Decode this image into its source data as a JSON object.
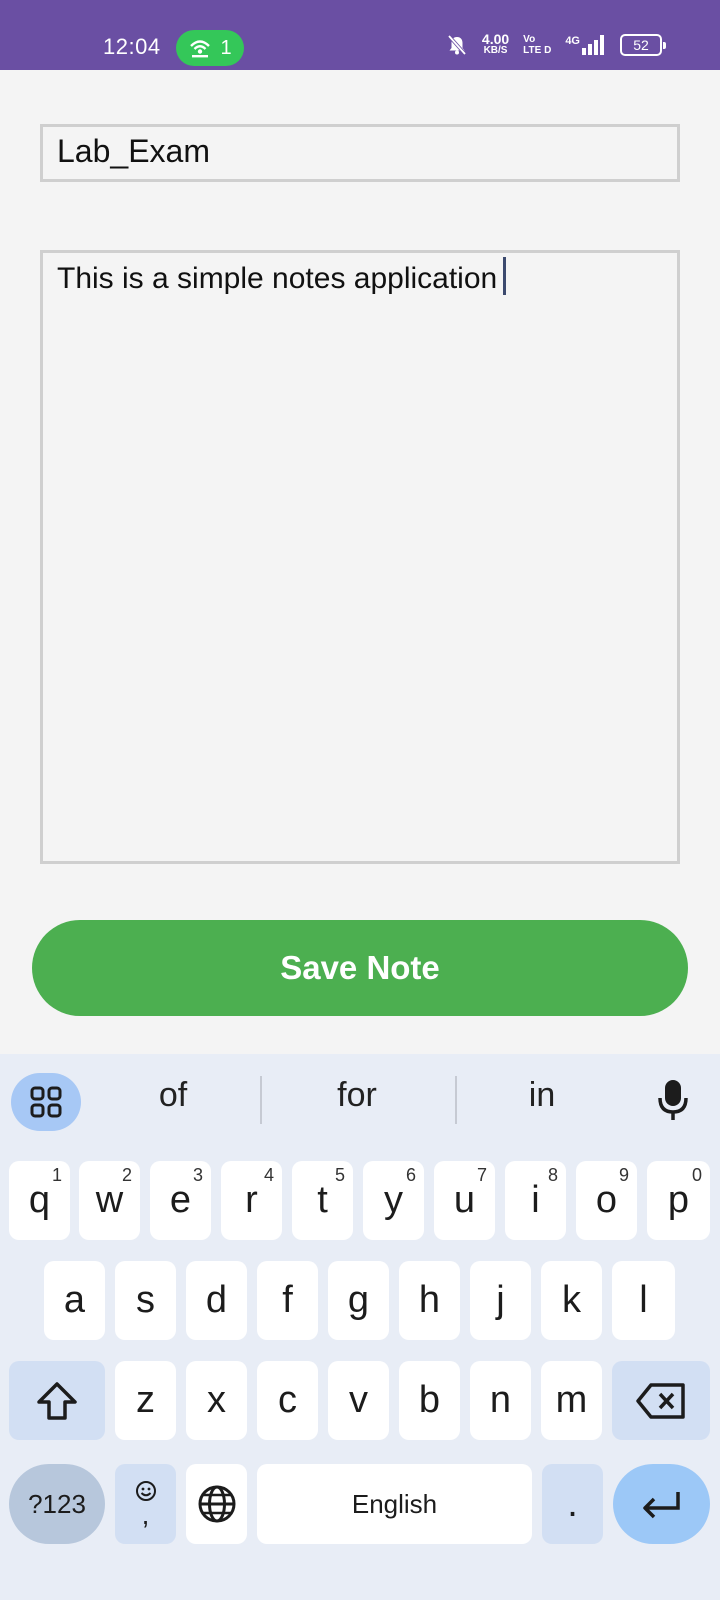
{
  "status_bar": {
    "time": "12:04",
    "hotspot_count": "1",
    "net_speed": "4.00",
    "net_speed_unit": "KB/S",
    "volte_top": "Vo",
    "volte_bottom": "LTE D",
    "network": "4G",
    "battery": "52",
    "colors": {
      "background": "#6a4fa3",
      "hotspot_pill": "#34c759"
    }
  },
  "note": {
    "title_value": "Lab_Exam",
    "content_value": "This is a simple notes application"
  },
  "save_button": {
    "label": "Save Note",
    "color": "#4caf50"
  },
  "keyboard": {
    "suggestions": [
      "of",
      "for",
      "in"
    ],
    "row1": [
      {
        "key": "q",
        "hint": "1"
      },
      {
        "key": "w",
        "hint": "2"
      },
      {
        "key": "e",
        "hint": "3"
      },
      {
        "key": "r",
        "hint": "4"
      },
      {
        "key": "t",
        "hint": "5"
      },
      {
        "key": "y",
        "hint": "6"
      },
      {
        "key": "u",
        "hint": "7"
      },
      {
        "key": "i",
        "hint": "8"
      },
      {
        "key": "o",
        "hint": "9"
      },
      {
        "key": "p",
        "hint": "0"
      }
    ],
    "row2": [
      "a",
      "s",
      "d",
      "f",
      "g",
      "h",
      "j",
      "k",
      "l"
    ],
    "row3": [
      "z",
      "x",
      "c",
      "v",
      "b",
      "n",
      "m"
    ],
    "symbols_label": "?123",
    "comma": ",",
    "space_label": "English",
    "period": "."
  }
}
